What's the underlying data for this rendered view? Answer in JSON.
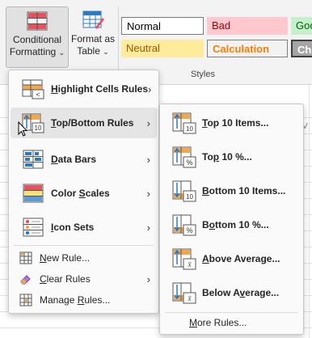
{
  "ribbon": {
    "conditional_formatting": {
      "line1": "Conditional",
      "line2": "Formatting",
      "caret": "⌄"
    },
    "format_as_table": {
      "line1": "Format as",
      "line2": "Table",
      "caret": "⌄"
    },
    "styles_group_label": "Styles",
    "cell_styles": {
      "normal": "Normal",
      "bad": "Bad",
      "good": "Goo",
      "neutral": "Neutral",
      "calculation": "Calculation",
      "check": "Che"
    },
    "column_letter": "V"
  },
  "main_menu": {
    "items": [
      {
        "label": "Highlight Cells Rules",
        "underline": "H",
        "has_submenu": true
      },
      {
        "label": "Top/Bottom Rules",
        "underline": "T",
        "has_submenu": true,
        "hover": true
      },
      {
        "label": "Data Bars",
        "underline": "D",
        "has_submenu": true
      },
      {
        "label": "Color Scales",
        "underline": "S",
        "has_submenu": true
      },
      {
        "label": "Icon Sets",
        "underline": "I",
        "has_submenu": true
      }
    ],
    "small_items": [
      {
        "label": "New Rule...",
        "underline": "N",
        "has_submenu": false
      },
      {
        "label": "Clear Rules",
        "underline": "C",
        "has_submenu": true
      },
      {
        "label": "Manage Rules...",
        "underline": "R",
        "has_submenu": false
      }
    ]
  },
  "sub_menu": {
    "items": [
      {
        "label": "Top 10 Items...",
        "underline": "T",
        "icon_text": "10"
      },
      {
        "label": "Top 10 %...",
        "underline": "P",
        "icon_text": "%"
      },
      {
        "label": "Bottom 10 Items...",
        "underline": "B",
        "icon_text": "10"
      },
      {
        "label": "Bottom 10 %...",
        "underline": "O",
        "icon_text": "%"
      },
      {
        "label": "Above Average...",
        "underline": "A",
        "icon_text": "x̄"
      },
      {
        "label": "Below Average...",
        "underline": "V",
        "icon_text": "x̄"
      }
    ],
    "more_rules": {
      "label": "More Rules...",
      "underline": "M"
    }
  },
  "colors": {
    "accent_blue": "#2b78c5",
    "icon_orange": "#f3a64a",
    "hover_bg": "#e5e5e5"
  }
}
